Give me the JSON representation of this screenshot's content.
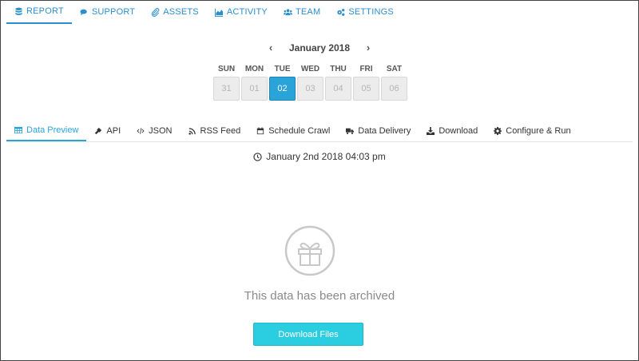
{
  "topnav": {
    "items": [
      {
        "label": "REPORT",
        "icon": "database-icon"
      },
      {
        "label": "SUPPORT",
        "icon": "comments-icon"
      },
      {
        "label": "ASSETS",
        "icon": "paperclip-icon"
      },
      {
        "label": "ACTIVITY",
        "icon": "area-chart-icon"
      },
      {
        "label": "TEAM",
        "icon": "users-icon"
      },
      {
        "label": "SETTINGS",
        "icon": "gears-icon"
      }
    ],
    "active": "REPORT"
  },
  "calendar": {
    "prev_arrow": "‹",
    "next_arrow": "›",
    "month_label": "January 2018",
    "days": [
      {
        "name": "SUN",
        "num": "31"
      },
      {
        "name": "MON",
        "num": "01"
      },
      {
        "name": "TUE",
        "num": "02"
      },
      {
        "name": "WED",
        "num": "03"
      },
      {
        "name": "THU",
        "num": "04"
      },
      {
        "name": "FRI",
        "num": "05"
      },
      {
        "name": "SAT",
        "num": "06"
      }
    ],
    "selected": "02"
  },
  "subtabs": {
    "items": [
      {
        "label": "Data Preview",
        "icon": "table-icon"
      },
      {
        "label": "API",
        "icon": "plug-icon"
      },
      {
        "label": "JSON",
        "icon": "code-icon"
      },
      {
        "label": "RSS Feed",
        "icon": "rss-icon"
      },
      {
        "label": "Schedule Crawl",
        "icon": "calendar-icon"
      },
      {
        "label": "Data Delivery",
        "icon": "truck-icon"
      },
      {
        "label": "Download",
        "icon": "download-icon"
      },
      {
        "label": "Configure & Run",
        "icon": "gear-icon"
      }
    ],
    "active": "Data Preview"
  },
  "main": {
    "timestamp": "January 2nd 2018 04:03 pm",
    "archived_message": "This data has been archived",
    "download_button": "Download Files"
  },
  "colors": {
    "accent": "#2a8fcb",
    "selected_day": "#2aa3d8",
    "download_button": "#2bcde0"
  }
}
